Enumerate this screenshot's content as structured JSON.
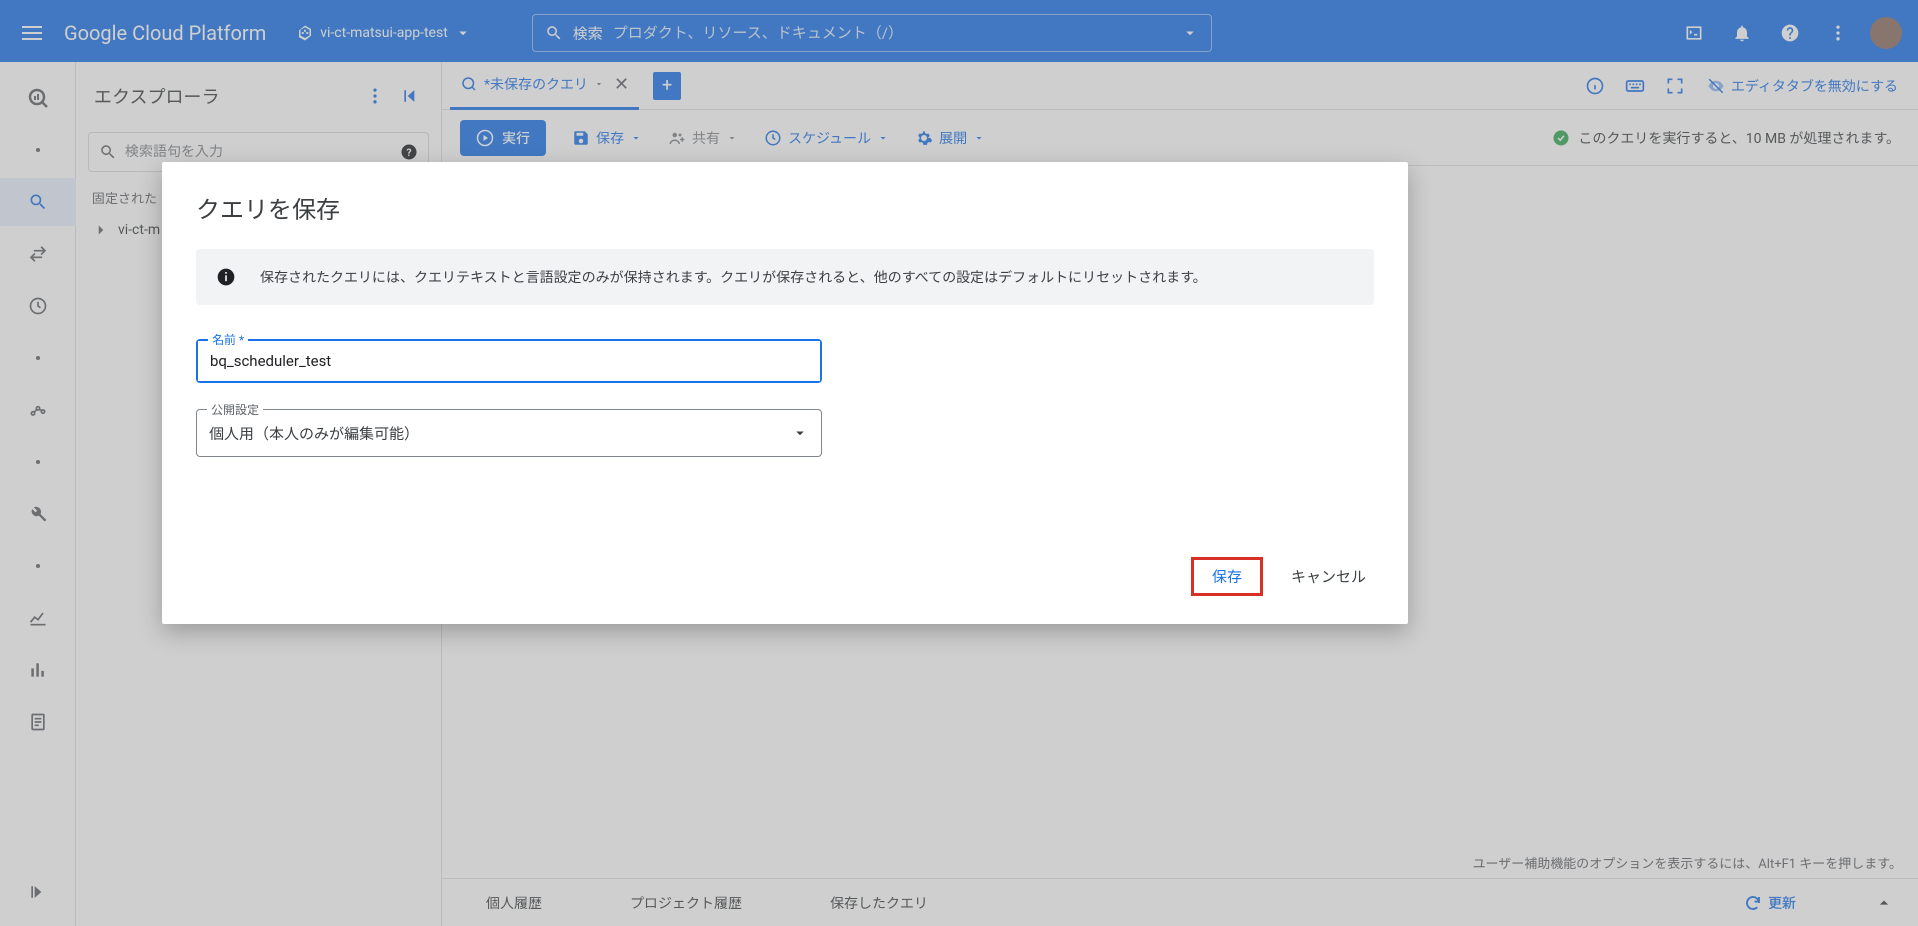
{
  "header": {
    "logo": "Google Cloud Platform",
    "project": "vi-ct-matsui-app-test",
    "search_label": "検索",
    "search_placeholder": "プロダクト、リソース、ドキュメント（/）"
  },
  "explorer": {
    "title": "エクスプローラ",
    "search_placeholder": "検索語句を入力",
    "pinned_label": "固定された",
    "tree_item": "vi-ct-m"
  },
  "tabs": {
    "active": "*未保存のクエリ",
    "disable_label": "エディタタブを無効にする"
  },
  "toolbar": {
    "run": "実行",
    "save": "保存",
    "share": "共有",
    "schedule": "スケジュール",
    "expand": "展開",
    "status": "このクエリを実行すると、10 MB が処理されます。"
  },
  "a11y_hint": "ユーザー補助機能のオプションを表示するには、Alt+F1 キーを押します。",
  "bottom": {
    "personal": "個人履歴",
    "project": "プロジェクト履歴",
    "saved": "保存したクエリ",
    "refresh": "更新"
  },
  "dialog": {
    "title": "クエリを保存",
    "info": "保存されたクエリには、クエリテキストと言語設定のみが保持されます。クエリが保存されると、他のすべての設定はデフォルトにリセットされます。",
    "name_label": "名前 *",
    "name_value": "bq_scheduler_test",
    "visibility_label": "公開設定",
    "visibility_value": "個人用（本人のみが編集可能）",
    "save": "保存",
    "cancel": "キャンセル"
  }
}
